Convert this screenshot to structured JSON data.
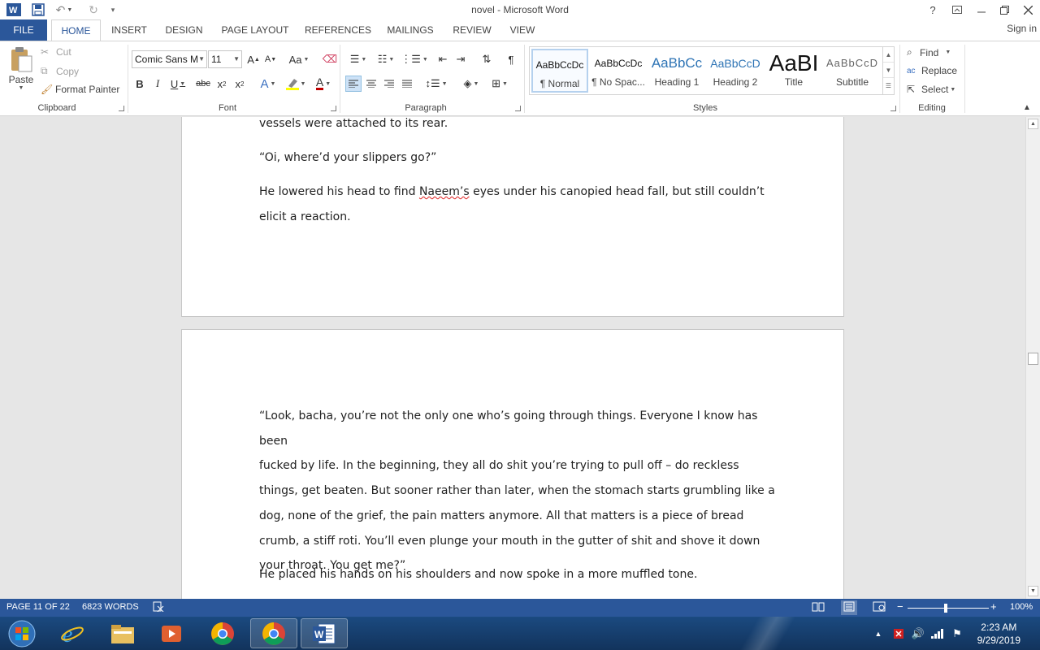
{
  "window": {
    "title": "novel - Microsoft Word",
    "help": "?",
    "sign_in": "Sign in"
  },
  "tabs": [
    {
      "label": "FILE"
    },
    {
      "label": "HOME"
    },
    {
      "label": "INSERT"
    },
    {
      "label": "DESIGN"
    },
    {
      "label": "PAGE LAYOUT"
    },
    {
      "label": "REFERENCES"
    },
    {
      "label": "MAILINGS"
    },
    {
      "label": "REVIEW"
    },
    {
      "label": "VIEW"
    }
  ],
  "clipboard": {
    "group": "Clipboard",
    "paste": "Paste",
    "cut": "Cut",
    "copy": "Copy",
    "format_painter": "Format Painter"
  },
  "font": {
    "group": "Font",
    "family": "Comic Sans M",
    "size": "11"
  },
  "paragraph": {
    "group": "Paragraph"
  },
  "styles": {
    "group": "Styles",
    "items": [
      {
        "preview": "AaBbCcDc",
        "name": "¶ Normal"
      },
      {
        "preview": "AaBbCcDc",
        "name": "¶ No Spac..."
      },
      {
        "preview": "AaBbCc",
        "name": "Heading 1"
      },
      {
        "preview": "AaBbCcD",
        "name": "Heading 2"
      },
      {
        "preview": "AaBI",
        "name": "Title"
      },
      {
        "preview": "AaBbCcD",
        "name": "Subtitle"
      }
    ]
  },
  "editing": {
    "group": "Editing",
    "find": "Find",
    "replace": "Replace",
    "select": "Select"
  },
  "document": {
    "page1_lines": [
      "vessels were attached to its rear.",
      "“Oi, where’d your slippers go?”"
    ],
    "page1_p3_before": "He lowered his head to find ",
    "page1_p3_name": "Naeem’s",
    "page1_p3_after": " eyes under his canopied head fall, but still couldn’t",
    "page1_p3_line2": "elicit a reaction.",
    "page2_lines": [
      "“Look, bacha, you’re not the only one who’s going through things. Everyone I know has been",
      "fucked by life. In the beginning, they all do shit you’re trying to pull off – do reckless",
      "things, get beaten. But sooner rather than later, when the stomach starts grumbling like a",
      "dog, none of the grief, the pain matters anymore. All that matters is a piece of bread",
      "crumb, a stiff roti. You’ll even plunge your mouth in the gutter of shit and shove it down",
      "your throat. You get me?”"
    ],
    "page2_last": "He placed his hands on his shoulders and now spoke in a more muffled tone."
  },
  "status": {
    "page": "PAGE 11 OF 22",
    "words": "6823 WORDS",
    "zoom": "100%",
    "zoom_level_pct": 100
  },
  "taskbar": {
    "time": "2:23 AM",
    "date": "9/29/2019"
  },
  "colors": {
    "accent": "#2b579a",
    "font_color": "#c00000",
    "highlight": "#ffff00"
  }
}
